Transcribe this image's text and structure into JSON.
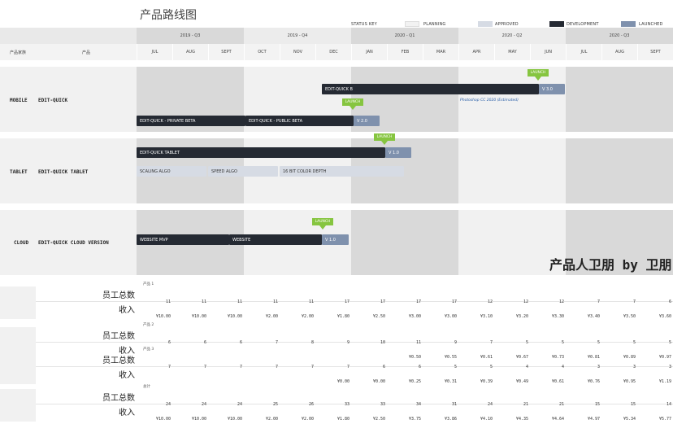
{
  "title": "产品路线图",
  "status_key": {
    "label": "STATUS KEY",
    "items": [
      {
        "label": "PLANNING",
        "color": "#f2f2f2"
      },
      {
        "label": "APPROVED",
        "color": "#d6dbe4"
      },
      {
        "label": "DEVELOPMENT",
        "color": "#252a33"
      },
      {
        "label": "LAUNCHED",
        "color": "#7f91ad"
      }
    ]
  },
  "header": {
    "col_family": "产品家族",
    "col_product": "产品",
    "quarters": [
      "2019 - Q3",
      "2019 - Q4",
      "2020 - Q1",
      "2020 - Q2",
      "2020 - Q3"
    ],
    "months": [
      "JUL",
      "AUG",
      "SEPT",
      "OCT",
      "NOV",
      "DEC",
      "JAN",
      "FEB",
      "MAR",
      "APR",
      "MAY",
      "JUN",
      "JUL",
      "AUG",
      "SEPT"
    ]
  },
  "families": [
    {
      "name": "MOBILE",
      "product": "EDIT-QUICK"
    },
    {
      "name": "TABLET",
      "product": "EDIT-QUICK TABLET"
    },
    {
      "name": "CLOUD",
      "product": "EDIT-QUICK CLOUD VERSION"
    }
  ],
  "bars": {
    "mobile_b": "EDIT-QUICK B",
    "mobile_v30": "V 3.0",
    "mobile_note": "Photoshop CC 2020 (Estimated)",
    "mobile_private": "EDIT-QUICK - PRIVATE BETA",
    "mobile_public": "EDIT-QUICK - PUBLIC BETA",
    "mobile_v20": "V 2.0",
    "tablet_main": "EDIT-QUICK TABLET",
    "tablet_v10": "V 1.0",
    "tablet_scaling": "SCALING ALGO",
    "tablet_speed": "SPEED ALGO",
    "tablet_color": "16 BIT COLOR DEPTH",
    "cloud_mvp": "WEBSITE MVP",
    "cloud_site": "WEBSITE",
    "cloud_v10": "V 1.0",
    "launch": "LAUNCH"
  },
  "watermark": "产品人卫朋 by 卫朋",
  "table": {
    "row_staff": "员工总数",
    "row_income": "收入",
    "sections": [
      {
        "label": "产品 1",
        "staff": [
          "11",
          "11",
          "11",
          "11",
          "11",
          "17",
          "17",
          "17",
          "17",
          "12",
          "12",
          "12",
          "7",
          "7",
          "6"
        ],
        "income": [
          "¥10.00",
          "¥10.00",
          "¥10.00",
          "¥2.00",
          "¥2.00",
          "¥1.80",
          "¥2.50",
          "¥3.00",
          "¥3.00",
          "¥3.10",
          "¥3.20",
          "¥3.30",
          "¥3.40",
          "¥3.50",
          "¥3.60"
        ]
      },
      {
        "label": "产品 2",
        "staff": [
          "6",
          "6",
          "6",
          "7",
          "8",
          "9",
          "10",
          "11",
          "9",
          "7",
          "5",
          "5",
          "5",
          "5",
          "5"
        ],
        "income": [
          "",
          "",
          "",
          "",
          "",
          "",
          "",
          "¥0.50",
          "¥0.55",
          "¥0.61",
          "¥0.67",
          "¥0.73",
          "¥0.81",
          "¥0.89",
          "¥0.97"
        ]
      },
      {
        "label": "产品 3",
        "staff": [
          "7",
          "7",
          "7",
          "7",
          "7",
          "7",
          "6",
          "6",
          "5",
          "5",
          "4",
          "4",
          "3",
          "3",
          "3"
        ],
        "income": [
          "",
          "",
          "",
          "",
          "",
          "¥0.00",
          "¥0.00",
          "¥0.25",
          "¥0.31",
          "¥0.39",
          "¥0.49",
          "¥0.61",
          "¥0.76",
          "¥0.95",
          "¥1.19"
        ]
      },
      {
        "label": "总计",
        "staff": [
          "24",
          "24",
          "24",
          "25",
          "26",
          "33",
          "33",
          "34",
          "31",
          "24",
          "21",
          "21",
          "15",
          "15",
          "14"
        ],
        "income": [
          "¥10.00",
          "¥10.00",
          "¥10.00",
          "¥2.00",
          "¥2.00",
          "¥1.80",
          "¥2.50",
          "¥3.75",
          "¥3.86",
          "¥4.10",
          "¥4.35",
          "¥4.64",
          "¥4.97",
          "¥5.34",
          "¥5.77"
        ]
      }
    ]
  }
}
